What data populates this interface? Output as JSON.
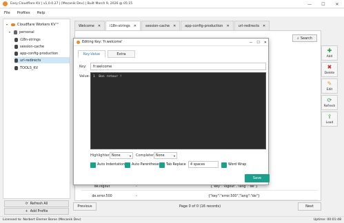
{
  "window": {
    "title": "Easy Cloudflare KV | v1.0.0.27 | [Mecanik Dev] | Built March 9, 2026 @ 05:15",
    "controls": [
      "—",
      "☐",
      "✕"
    ]
  },
  "menu": [
    "File",
    "Profiles",
    "Help"
  ],
  "sidebar": {
    "root": "Cloudflare Workers KV™",
    "profile": "personal",
    "namespaces": [
      "i18n-strings",
      "session-cache",
      "app-config-production",
      "url-redirects",
      "TOOLS_KV"
    ],
    "selected": "url-redirects",
    "refresh_label": "Refresh All",
    "add_profile_label": "Add Profile"
  },
  "tabs": [
    {
      "label": "Welcome"
    },
    {
      "label": "i18n-strings"
    },
    {
      "label": "session-cache"
    },
    {
      "label": "app-config-production"
    },
    {
      "label": "url-redirects"
    }
  ],
  "active_tab": "i18n-strings",
  "search": {
    "label": "Search"
  },
  "grid": {
    "rows": [
      {
        "key": "de.logout",
        "sep": "-",
        "value": "{\"key\":\"logout\",\"lang\":\"de\"}"
      },
      {
        "key": "de.error.500",
        "sep": "-",
        "value": "{\"key\":\"error.500\",\"lang\":\"de\"}"
      }
    ]
  },
  "pager": {
    "previous": "Previous",
    "info": "Page 0 of 0 (16 records)",
    "next": "Next"
  },
  "toolbar": [
    {
      "label": "Add",
      "icon": "plus-icon",
      "color": "#2e9e3e"
    },
    {
      "label": "Delete",
      "icon": "delete-icon",
      "color": "#cc2b2b"
    },
    {
      "label": "Edit",
      "icon": "edit-icon",
      "color": "#e0a020"
    },
    {
      "label": "Refresh",
      "icon": "refresh-icon",
      "color": "#2e9e3e"
    },
    {
      "label": "Load",
      "icon": "load-icon",
      "color": "#2e9e3e"
    }
  ],
  "status": {
    "license": "Licensed to: Norbert Elemer Boros (Mecanik Dev)",
    "uptime": "Uptime: 00:01:48"
  },
  "dialog": {
    "title": "Editing Key: 'fr.welcome'",
    "tabs": [
      "Key-Value",
      "Extra"
    ],
    "key_label": "Key:",
    "key_value": "fr.welcome",
    "value_label": "Value:",
    "editor_line": "1  Bon retour !",
    "highlighter_label": "Highlighter",
    "highlighter_value": "None",
    "completer_label": "Completer",
    "completer_value": "None",
    "auto_indent": "Auto Indentation",
    "auto_paren": "Auto Parentheses",
    "tab_replace": "Tab Replace",
    "spaces_value": "4 spaces",
    "word_wrap": "Word Wrap",
    "save_label": "Save",
    "accent": "#1aa08c"
  }
}
